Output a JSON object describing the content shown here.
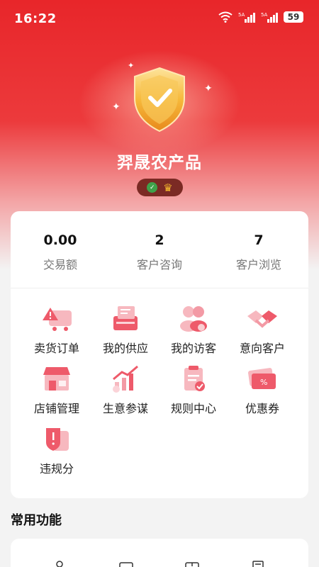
{
  "status_bar": {
    "time": "16:22",
    "battery": "59",
    "signal_label": "5A"
  },
  "shop": {
    "name": "羿晟农产品"
  },
  "stats": [
    {
      "value": "0.00",
      "label": "交易额"
    },
    {
      "value": "2",
      "label": "客户咨询"
    },
    {
      "value": "7",
      "label": "客户浏览"
    }
  ],
  "grid": [
    {
      "label": "卖货订单",
      "icon": "sell-order-icon"
    },
    {
      "label": "我的供应",
      "icon": "my-supply-icon"
    },
    {
      "label": "我的访客",
      "icon": "my-visitors-icon"
    },
    {
      "label": "意向客户",
      "icon": "intended-customers-icon"
    },
    {
      "label": "店铺管理",
      "icon": "store-management-icon"
    },
    {
      "label": "生意参谋",
      "icon": "business-analytics-icon"
    },
    {
      "label": "规则中心",
      "icon": "rules-center-icon"
    },
    {
      "label": "优惠券",
      "icon": "coupon-icon"
    },
    {
      "label": "违规分",
      "icon": "violation-score-icon"
    }
  ],
  "common_functions": {
    "title": "常用功能"
  },
  "colors": {
    "brand_red": "#e8262a",
    "icon_pink": "#f27a86",
    "shield_gold": "#f6b93b"
  }
}
